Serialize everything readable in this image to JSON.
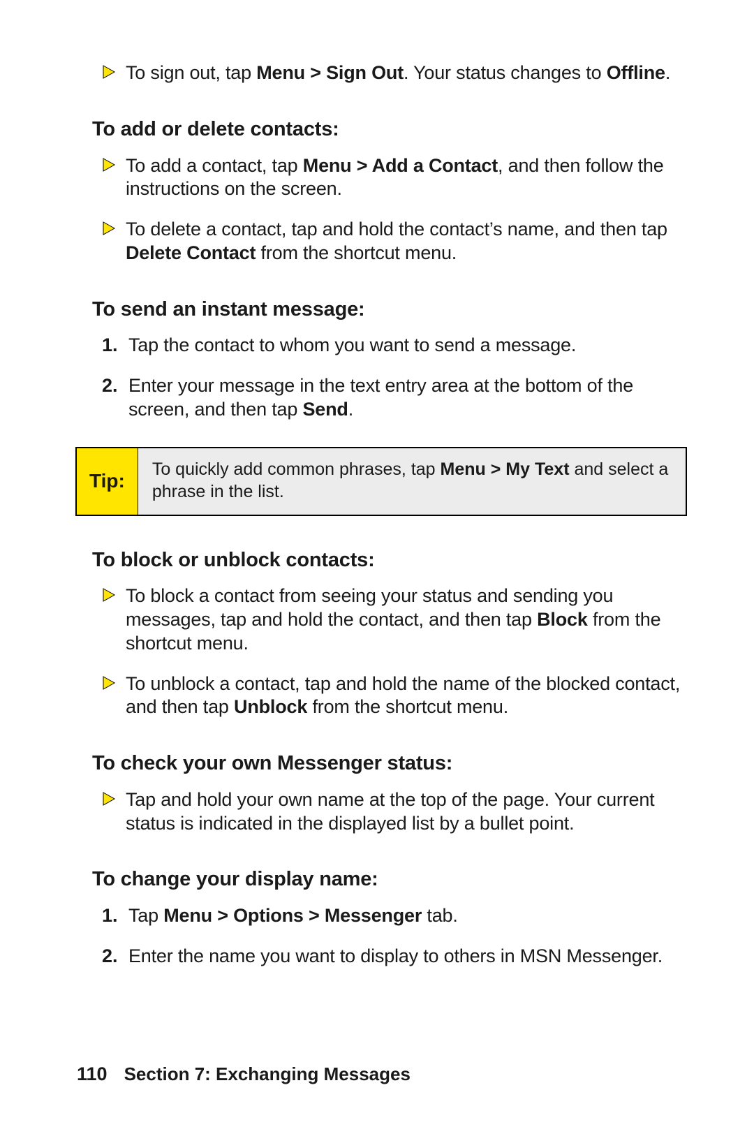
{
  "colors": {
    "yellow": "#ffe500",
    "grey": "#ececec"
  },
  "intro_signout": {
    "before": "To sign out, tap ",
    "bold1": "Menu > Sign Out",
    "mid": ". Your status changes to ",
    "bold2": "Offline",
    "after": "."
  },
  "sec_addDelete": {
    "heading": "To add or delete contacts:",
    "items": [
      {
        "before": "To add a contact, tap ",
        "bold": "Menu > Add a Contact",
        "after": ", and then follow the instructions on the screen."
      },
      {
        "before": "To delete a contact, tap and hold the contact’s name, and then tap ",
        "bold": "Delete Contact",
        "after": " from the shortcut menu."
      }
    ]
  },
  "sec_sendIM": {
    "heading": "To send an instant message:",
    "steps": [
      {
        "num": "1.",
        "before": "Tap the contact to whom you want to send a message.",
        "bold": "",
        "after": ""
      },
      {
        "num": "2.",
        "before": "Enter your message in the text entry area at the bottom of the screen, and then tap ",
        "bold": "Send",
        "after": "."
      }
    ]
  },
  "tip": {
    "label": "Tip:",
    "before": "To quickly add common phrases, tap ",
    "bold": "Menu > My Text",
    "after": " and select a phrase in the list."
  },
  "sec_block": {
    "heading": "To block or unblock contacts:",
    "items": [
      {
        "before": "To block a contact from seeing your status and sending you messages, tap and hold the contact, and then tap ",
        "bold": "Block",
        "after": " from the shortcut menu."
      },
      {
        "before": "To unblock a contact, tap and hold the name of the blocked contact, and then tap ",
        "bold": "Unblock",
        "after": " from the shortcut menu."
      }
    ]
  },
  "sec_checkStatus": {
    "heading": "To check your own Messenger status:",
    "items": [
      {
        "before": "Tap and hold your own name at the top of the page. Your current status is indicated in the displayed list by a bullet point.",
        "bold": "",
        "after": ""
      }
    ]
  },
  "sec_displayName": {
    "heading": "To change your display name:",
    "steps": [
      {
        "num": "1.",
        "before": "Tap ",
        "bold": "Menu > Options > Messenger",
        "after": " tab."
      },
      {
        "num": "2.",
        "before": "Enter the name you want to display to others in MSN Messenger.",
        "bold": "",
        "after": ""
      }
    ]
  },
  "footer": {
    "page": "110",
    "section": "Section 7: Exchanging Messages"
  }
}
